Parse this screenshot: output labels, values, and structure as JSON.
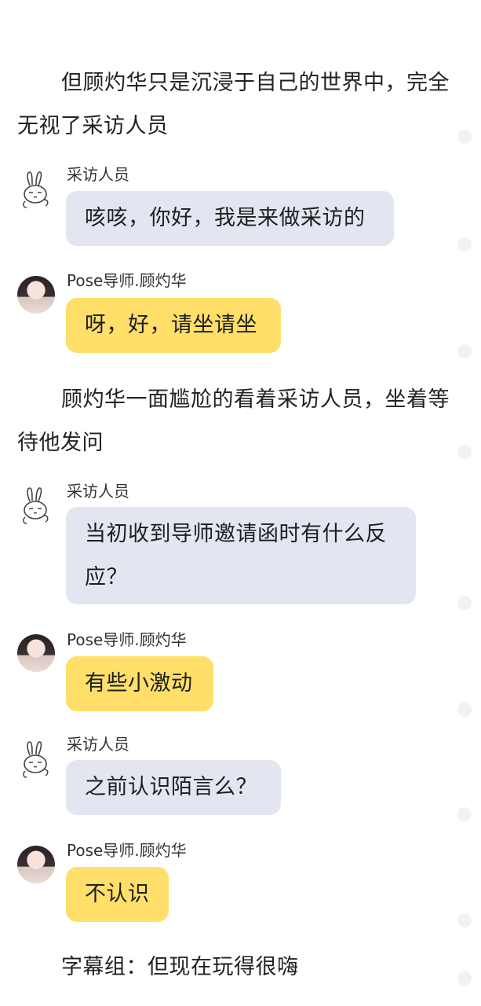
{
  "narration": [
    "但顾灼华只是沉浸于自己的世界中，完全无视了采访人员",
    "顾灼华一面尴尬的看着采访人员，坐着等待他发问",
    "字幕组：但现在玩得很嗨"
  ],
  "messages": [
    {
      "speaker": "采访人员",
      "text": "咳咳，你好，我是来做采访的"
    },
    {
      "speaker": "Pose导师.顾灼华",
      "text": "呀，好，请坐请坐"
    },
    {
      "speaker": "采访人员",
      "text": "当初收到导师邀请函时有什么反应？"
    },
    {
      "speaker": "Pose导师.顾灼华",
      "text": "有些小激动"
    },
    {
      "speaker": "采访人员",
      "text": "之前认识陌言么？"
    },
    {
      "speaker": "Pose导师.顾灼华",
      "text": "不认识"
    }
  ],
  "colors": {
    "interviewer_bubble": "#e3e6f0",
    "mentor_bubble": "#ffdf6a"
  },
  "icons": {
    "interviewer_avatar": "rabbit-doodle-icon",
    "mentor_avatar": "girl-photo-avatar"
  }
}
